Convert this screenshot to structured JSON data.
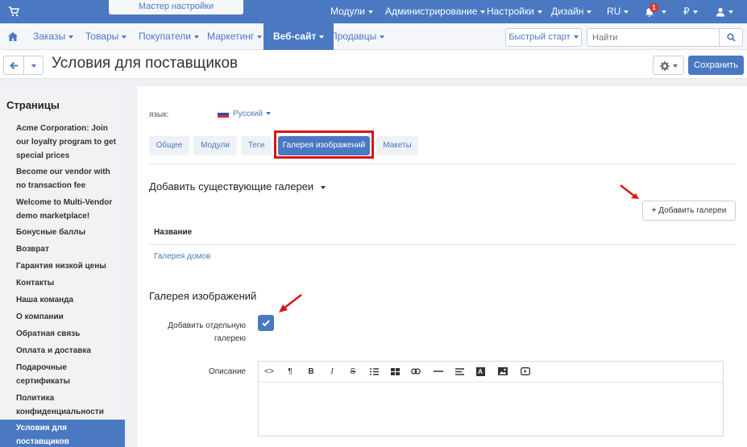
{
  "topbar": {
    "wizard_label": "Мастер настройки маркетплейса",
    "menus": [
      "Модули",
      "Администрирование",
      "Настройки",
      "Дизайн",
      "RU",
      "₽"
    ],
    "notification_count": "1"
  },
  "navbar": {
    "items": [
      "Заказы",
      "Товары",
      "Покупатели",
      "Маркетинг",
      "Веб-сайт",
      "Продавцы"
    ],
    "active_item": "Веб-сайт",
    "quick_start": "Быстрый старт",
    "search_placeholder": "Найти"
  },
  "page": {
    "title": "Условия для поставщиков",
    "save_label": "Сохранить"
  },
  "sidebar": {
    "heading": "Страницы",
    "items": [
      "Acme Corporation: Join our loyalty program to get special prices",
      "Become our vendor with no transaction fee",
      "Welcome to Multi-Vendor demo marketplace!",
      "Бонусные баллы",
      "Возврат",
      "Гарантия низкой цены",
      "Контакты",
      "Наша команда",
      "О компании",
      "Обратная связь",
      "Оплата и доставка",
      "Подарочные сертификаты",
      "Политика конфиденциальности",
      "Условия для поставщиков"
    ]
  },
  "main": {
    "lang_label": "язык:",
    "lang_value": "Русский",
    "tabs": [
      "Общее",
      "Модули",
      "Теги",
      "Галерея изображений",
      "Макеты"
    ],
    "active_tab": "Галерея изображений",
    "existing_galleries_title": "Добавить существующие галереи",
    "add_galleries_label": "Добавить галереи",
    "table_header_name": "Название",
    "gallery_row": "Галерея домов",
    "gallery_section_title": "Галерея изображений",
    "add_separate_gallery_label": "Добавить отдельную галерею",
    "add_separate_gallery_checked": true,
    "description_label": "Описание",
    "editor_toolbar": [
      "<>",
      "¶",
      "B",
      "I",
      "S",
      "ul",
      "table",
      "link",
      "hr",
      "align",
      "A",
      "image",
      "video"
    ]
  },
  "colors": {
    "accent": "#4a79c2",
    "highlight": "#d91616"
  }
}
